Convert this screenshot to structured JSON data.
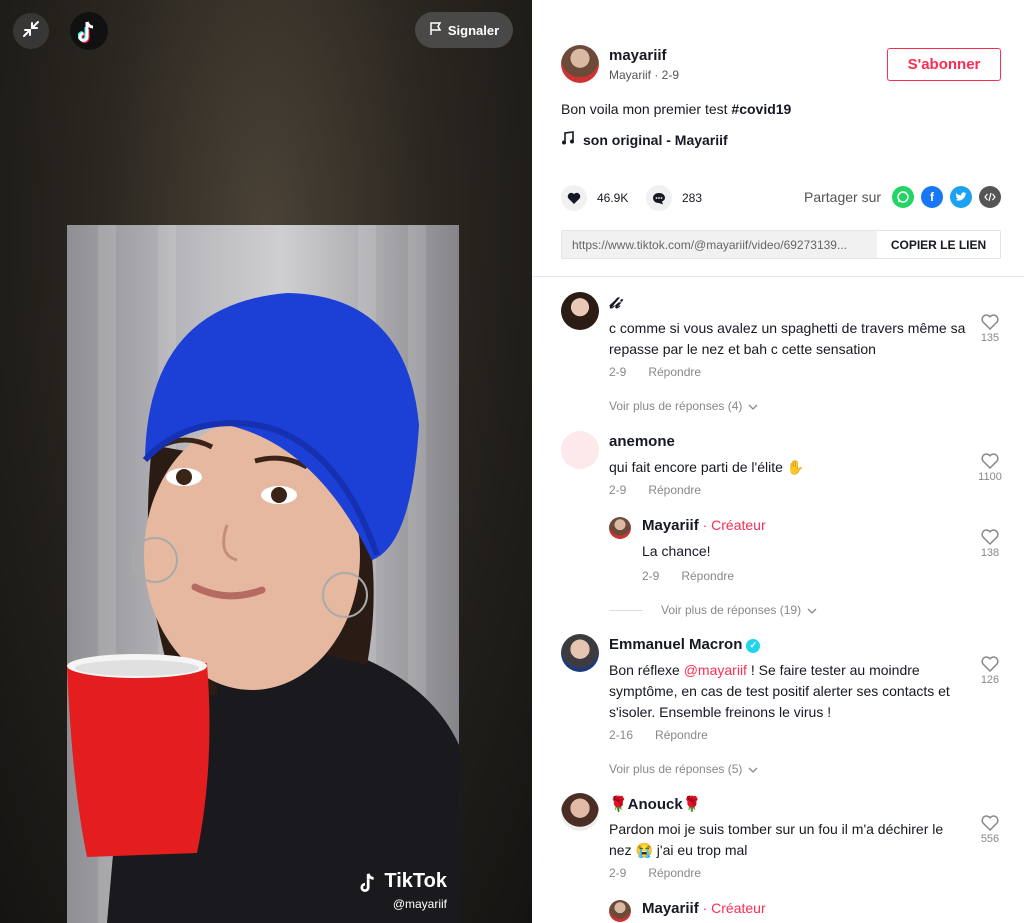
{
  "video": {
    "report_label": "Signaler",
    "watermark_brand": "TikTok",
    "watermark_handle": "@mayariif"
  },
  "author": {
    "username": "mayariif",
    "display_and_date": "Mayariif · 2-9",
    "follow_label": "S'abonner"
  },
  "caption": {
    "text": "Bon voila mon premier test ",
    "hashtag": "#covid19"
  },
  "music": {
    "title": "son original - Mayariif"
  },
  "stats": {
    "likes": "46.9K",
    "comments": "283"
  },
  "share": {
    "label": "Partager sur",
    "link": "https://www.tiktok.com/@mayariif/video/69273139...",
    "copy_label": "COPIER LE LIEN"
  },
  "comments": [
    {
      "name": "𝓵𝓲",
      "text": "c comme si vous avalez un spaghetti de travers même sa repasse par le nez et bah c cette sensation",
      "date": "2-9",
      "reply_label": "Répondre",
      "likes": "135",
      "more_replies": "Voir plus de réponses (4)"
    },
    {
      "name": "anemone",
      "text": "qui fait encore parti de l'élite ✋",
      "date": "2-9",
      "reply_label": "Répondre",
      "likes": "1100",
      "reply": {
        "name": "Mayariif",
        "creator": " · Créateur",
        "text": "La chance!",
        "date": "2-9",
        "reply_label": "Répondre",
        "likes": "138"
      },
      "more_replies": "Voir plus de réponses (19)"
    },
    {
      "name": "Emmanuel Macron",
      "text_pre": "Bon réflexe ",
      "mention": "@mayariif",
      "text_post": " ! Se faire tester au moindre symptôme, en cas de test positif alerter ses contacts et s'isoler. Ensemble freinons le virus !",
      "date": "2-16",
      "reply_label": "Répondre",
      "likes": "126",
      "more_replies": "Voir plus de réponses (5)"
    },
    {
      "name": "🌹Anouck🌹",
      "text": "Pardon moi je suis tomber sur un fou il m'a déchirer le nez 😭 j'ai eu trop mal",
      "date": "2-9",
      "reply_label": "Répondre",
      "likes": "556",
      "reply": {
        "name": "Mayariif",
        "creator": " · Créateur"
      }
    }
  ],
  "colors": {
    "accent": "#fe2c55",
    "whatsapp": "#25d366",
    "facebook": "#1877f2",
    "twitter": "#1da1f2",
    "embed": "#555555"
  }
}
